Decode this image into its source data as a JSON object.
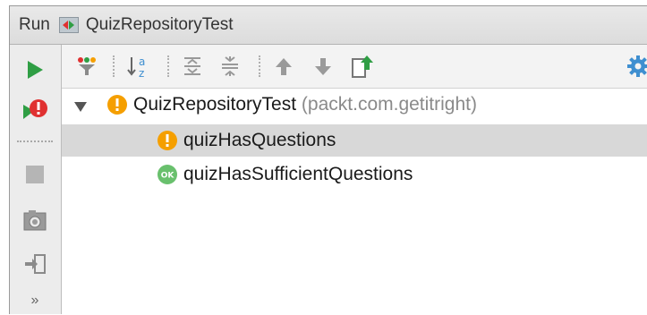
{
  "panel": {
    "label": "Run",
    "config_icon": "junit-config-icon",
    "config_name": "QuizRepositoryTest"
  },
  "sidebar": {
    "buttons": [
      {
        "name": "rerun-icon",
        "color": "#2f9e44"
      },
      {
        "name": "rerun-failed-icon",
        "color": "#e03131"
      },
      {
        "name": "stop-icon",
        "color": "#b5b5b5"
      },
      {
        "name": "dump-threads-icon",
        "color": "#8a8a8a"
      },
      {
        "name": "exit-icon",
        "color": "#8a8a8a"
      }
    ],
    "more_label": "»"
  },
  "toolbar": {
    "buttons": [
      "filter-results-icon",
      "sort-alphabetically-icon",
      "expand-all-icon",
      "collapse-all-icon",
      "previous-failed-icon",
      "next-failed-icon",
      "export-results-icon",
      "settings-gear-icon"
    ]
  },
  "tree": {
    "root": {
      "name": "QuizRepositoryTest",
      "package": "(packt.com.getitright)",
      "status": "warning",
      "expanded": true
    },
    "children": [
      {
        "name": "quizHasQuestions",
        "status": "warning",
        "selected": true
      },
      {
        "name": "quizHasSufficientQuestions",
        "status": "ok",
        "badge": "OK",
        "selected": false
      }
    ]
  },
  "colors": {
    "warning": "#f59f00",
    "ok": "#69c06d",
    "selection": "#d8d8d8",
    "gear": "#3f8fd0"
  }
}
